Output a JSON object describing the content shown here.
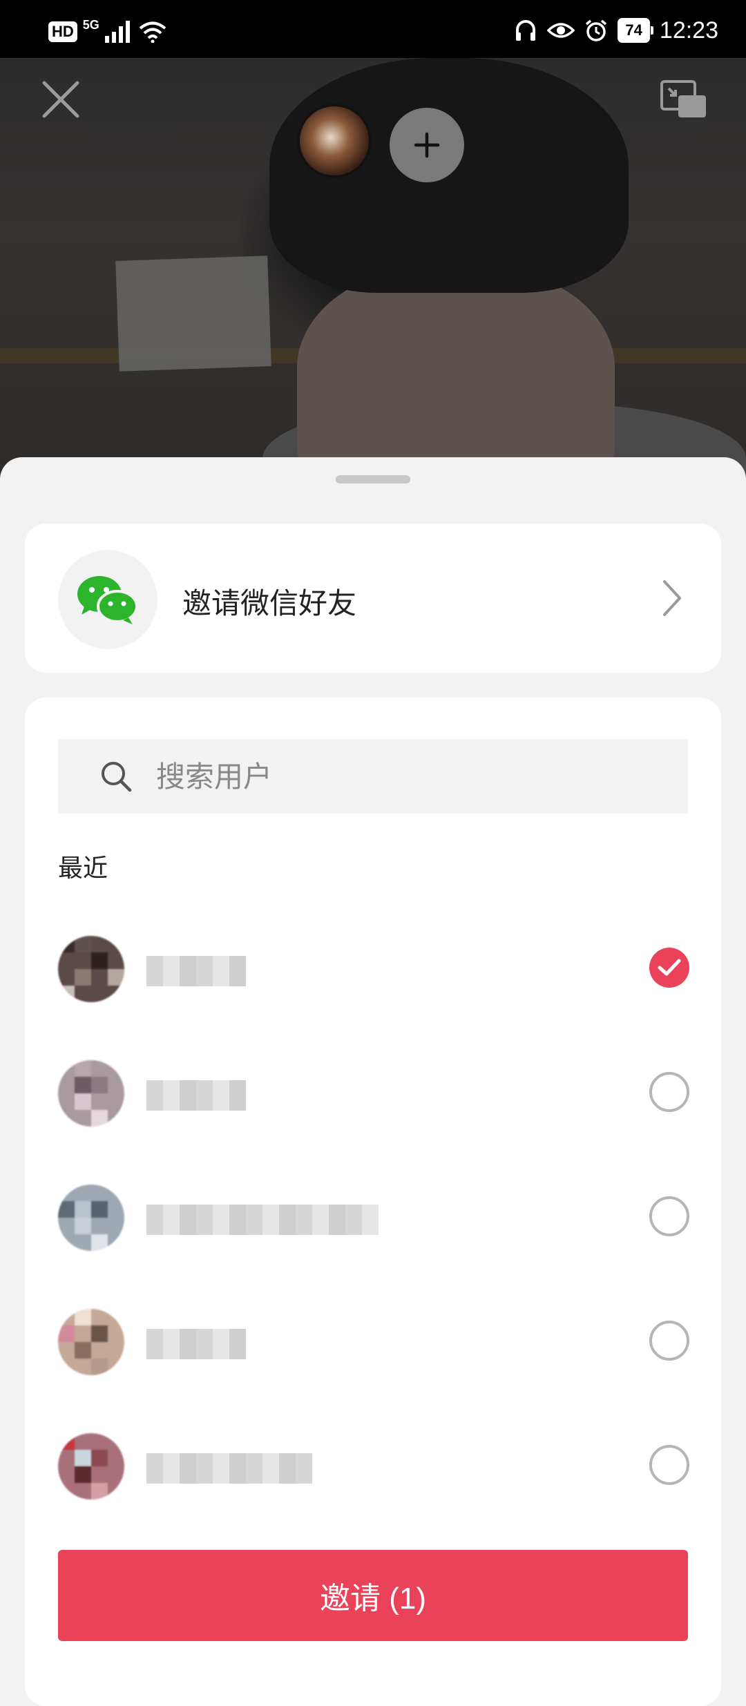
{
  "status_bar": {
    "left_badges": [
      "HD",
      "5G"
    ],
    "battery": "74",
    "time": "12:23",
    "icons": [
      "headphones-icon",
      "eye-icon",
      "alarm-icon",
      "battery-icon",
      "signal-icon",
      "wifi-icon"
    ]
  },
  "video": {
    "icons": [
      "close-icon",
      "pip-icon",
      "plus-icon"
    ]
  },
  "wechat_invite": {
    "label": "邀请微信好友",
    "icon": "wechat-icon",
    "brand_color": "#2db42d"
  },
  "search": {
    "placeholder": "搜索用户",
    "value": ""
  },
  "recent": {
    "title": "最近",
    "users": [
      {
        "name": "",
        "checked": true
      },
      {
        "name": "",
        "checked": false
      },
      {
        "name": "",
        "checked": false
      },
      {
        "name": "",
        "checked": false
      },
      {
        "name": "",
        "checked": false
      }
    ]
  },
  "invite_button": {
    "label": "邀请 (1)"
  },
  "colors": {
    "accent": "#ea4259",
    "radio_border": "#b5b5b5"
  }
}
